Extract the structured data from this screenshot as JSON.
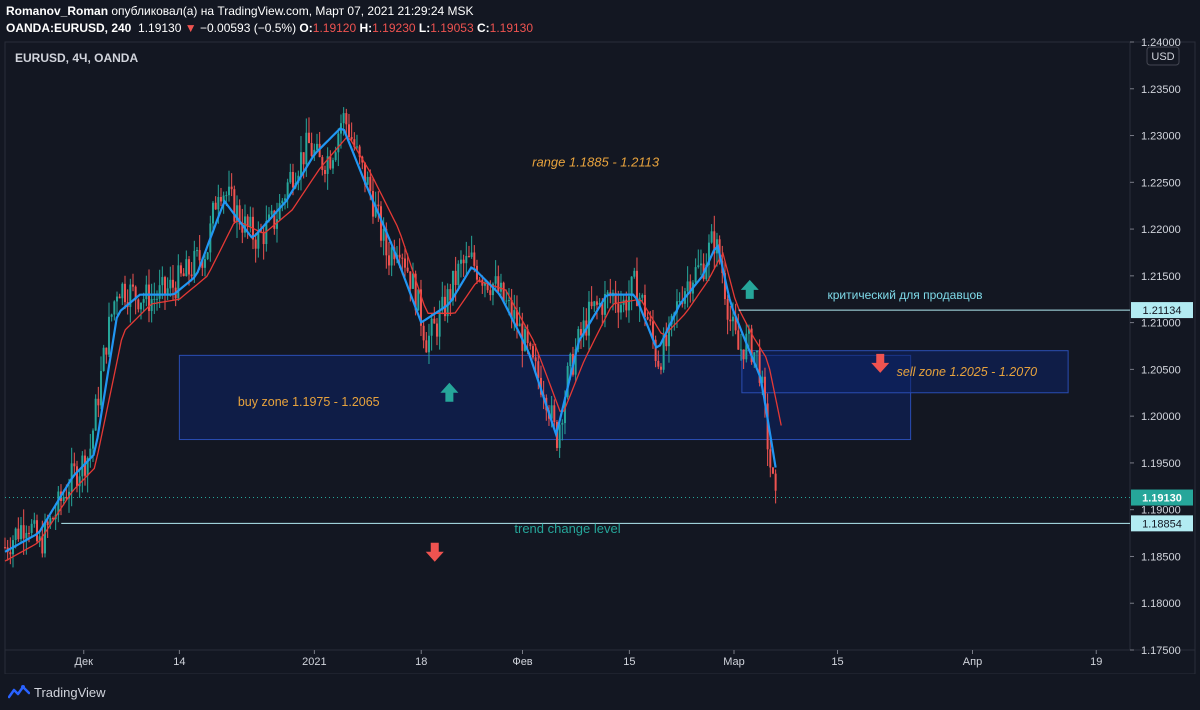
{
  "header": {
    "author": "Romanov_Roman",
    "published_text": "опубликовал(а) на TradingView.com, Март 07, 2021 21:29:24 MSK",
    "symbol": "OANDA:EURUSD, 240",
    "last": "1.19130",
    "change_arrow": "▼",
    "change": "−0.00593 (−0.5%)",
    "o_label": "O:",
    "o_value": "1.19120",
    "h_label": "H:",
    "h_value": "1.19230",
    "l_label": "L:",
    "l_value": "1.19053",
    "c_label": "C:",
    "c_value": "1.19130"
  },
  "footer": {
    "brand": "TradingView",
    "brand_icon": "tradingview-logo-icon"
  },
  "colors": {
    "background": "#131722",
    "up_candle": "#26a69a",
    "down_candle": "#ef5350",
    "ma_fast": "#2196f3",
    "ma_slow": "#e53935",
    "zone_fill": "#0d2266",
    "zone_border": "#2a4db3",
    "annotation_text": "#e8a33d",
    "level_line": "#b2ebf2",
    "trend_text": "#26a69a"
  },
  "chart_data": {
    "type": "candlestick",
    "title": "EURUSD, 4Ч, OANDA",
    "currency_label": "USD",
    "y_axis": {
      "ylim": [
        1.175,
        1.24
      ],
      "ticks": [
        "1.17500",
        "1.18000",
        "1.18500",
        "1.19000",
        "1.19500",
        "1.20000",
        "1.20500",
        "1.21000",
        "1.21500",
        "1.22000",
        "1.22500",
        "1.23000",
        "1.23500",
        "1.24000"
      ]
    },
    "x_axis": {
      "ticks": [
        {
          "label": "Дек",
          "t": 0.07
        },
        {
          "label": "14",
          "t": 0.155
        },
        {
          "label": "2021",
          "t": 0.275
        },
        {
          "label": "18",
          "t": 0.37
        },
        {
          "label": "Фев",
          "t": 0.46
        },
        {
          "label": "15",
          "t": 0.555
        },
        {
          "label": "Мар",
          "t": 0.648
        },
        {
          "label": "15",
          "t": 0.74
        },
        {
          "label": "Апр",
          "t": 0.86
        },
        {
          "label": "19",
          "t": 0.97
        }
      ]
    },
    "price_path": [
      [
        0.0,
        1.186
      ],
      [
        0.02,
        1.189
      ],
      [
        0.03,
        1.186
      ],
      [
        0.05,
        1.191
      ],
      [
        0.06,
        1.1935
      ],
      [
        0.075,
        1.196
      ],
      [
        0.09,
        1.208
      ],
      [
        0.1,
        1.214
      ],
      [
        0.115,
        1.213
      ],
      [
        0.13,
        1.2125
      ],
      [
        0.145,
        1.2135
      ],
      [
        0.16,
        1.215
      ],
      [
        0.18,
        1.218
      ],
      [
        0.19,
        1.225
      ],
      [
        0.2,
        1.223
      ],
      [
        0.215,
        1.22
      ],
      [
        0.225,
        1.219
      ],
      [
        0.24,
        1.221
      ],
      [
        0.255,
        1.226
      ],
      [
        0.27,
        1.229
      ],
      [
        0.28,
        1.227
      ],
      [
        0.29,
        1.228
      ],
      [
        0.3,
        1.232
      ],
      [
        0.305,
        1.231
      ],
      [
        0.315,
        1.227
      ],
      [
        0.325,
        1.224
      ],
      [
        0.34,
        1.217
      ],
      [
        0.35,
        1.219
      ],
      [
        0.365,
        1.213
      ],
      [
        0.375,
        1.208
      ],
      [
        0.385,
        1.21
      ],
      [
        0.395,
        1.213
      ],
      [
        0.405,
        1.216
      ],
      [
        0.415,
        1.2165
      ],
      [
        0.425,
        1.215
      ],
      [
        0.435,
        1.214
      ],
      [
        0.445,
        1.212
      ],
      [
        0.455,
        1.21
      ],
      [
        0.47,
        1.205
      ],
      [
        0.48,
        1.203
      ],
      [
        0.49,
        1.1975
      ],
      [
        0.5,
        1.204
      ],
      [
        0.51,
        1.208
      ],
      [
        0.52,
        1.211
      ],
      [
        0.53,
        1.212
      ],
      [
        0.54,
        1.213
      ],
      [
        0.55,
        1.212
      ],
      [
        0.56,
        1.214
      ],
      [
        0.57,
        1.211
      ],
      [
        0.58,
        1.206
      ],
      [
        0.59,
        1.208
      ],
      [
        0.6,
        1.213
      ],
      [
        0.61,
        1.215
      ],
      [
        0.62,
        1.216
      ],
      [
        0.63,
        1.219
      ],
      [
        0.637,
        1.216
      ],
      [
        0.645,
        1.21
      ],
      [
        0.652,
        1.207
      ],
      [
        0.66,
        1.208
      ],
      [
        0.67,
        1.206
      ],
      [
        0.68,
        1.195
      ],
      [
        0.685,
        1.1905
      ]
    ],
    "ma_fast_path": [
      [
        0.0,
        1.1855
      ],
      [
        0.03,
        1.1875
      ],
      [
        0.06,
        1.1935
      ],
      [
        0.08,
        1.196
      ],
      [
        0.1,
        1.211
      ],
      [
        0.12,
        1.213
      ],
      [
        0.15,
        1.213
      ],
      [
        0.17,
        1.215
      ],
      [
        0.195,
        1.223
      ],
      [
        0.22,
        1.219
      ],
      [
        0.25,
        1.223
      ],
      [
        0.275,
        1.228
      ],
      [
        0.3,
        1.231
      ],
      [
        0.32,
        1.225
      ],
      [
        0.345,
        1.218
      ],
      [
        0.37,
        1.21
      ],
      [
        0.395,
        1.212
      ],
      [
        0.415,
        1.216
      ],
      [
        0.44,
        1.213
      ],
      [
        0.465,
        1.207
      ],
      [
        0.49,
        1.198
      ],
      [
        0.51,
        1.208
      ],
      [
        0.535,
        1.213
      ],
      [
        0.56,
        1.213
      ],
      [
        0.58,
        1.207
      ],
      [
        0.6,
        1.212
      ],
      [
        0.62,
        1.215
      ],
      [
        0.633,
        1.2185
      ],
      [
        0.645,
        1.212
      ],
      [
        0.66,
        1.2075
      ],
      [
        0.672,
        1.204
      ],
      [
        0.685,
        1.1945
      ]
    ],
    "ma_slow_path": [
      [
        0.0,
        1.1845
      ],
      [
        0.03,
        1.1865
      ],
      [
        0.06,
        1.192
      ],
      [
        0.08,
        1.1945
      ],
      [
        0.105,
        1.209
      ],
      [
        0.13,
        1.212
      ],
      [
        0.155,
        1.2125
      ],
      [
        0.18,
        1.215
      ],
      [
        0.205,
        1.221
      ],
      [
        0.23,
        1.2195
      ],
      [
        0.255,
        1.222
      ],
      [
        0.28,
        1.2265
      ],
      [
        0.305,
        1.23
      ],
      [
        0.325,
        1.226
      ],
      [
        0.35,
        1.22
      ],
      [
        0.375,
        1.211
      ],
      [
        0.4,
        1.211
      ],
      [
        0.42,
        1.2145
      ],
      [
        0.445,
        1.2135
      ],
      [
        0.47,
        1.208
      ],
      [
        0.495,
        1.2
      ],
      [
        0.515,
        1.206
      ],
      [
        0.54,
        1.212
      ],
      [
        0.565,
        1.2125
      ],
      [
        0.585,
        1.2085
      ],
      [
        0.605,
        1.211
      ],
      [
        0.625,
        1.2145
      ],
      [
        0.638,
        1.2175
      ],
      [
        0.65,
        1.212
      ],
      [
        0.665,
        1.2085
      ],
      [
        0.678,
        1.206
      ],
      [
        0.69,
        1.199
      ]
    ],
    "zones": [
      {
        "name": "buy-zone",
        "t0": 0.155,
        "t1": 0.805,
        "p_low": 1.1975,
        "p_high": 1.2065,
        "label": "buy zone 1.1975 - 1.2065",
        "label_t": 0.27,
        "label_p": 1.2015
      },
      {
        "name": "sell-zone",
        "t0": 0.655,
        "t1": 0.945,
        "p_low": 1.2025,
        "p_high": 1.207,
        "label": "sell zone 1.2025 - 1.2070",
        "label_t": 0.855,
        "label_p": 1.2047
      }
    ],
    "levels": [
      {
        "name": "critical-level",
        "price": 1.21134,
        "label": "1.21134",
        "t0": 0.652,
        "text": "критический для продавцов",
        "text_t": 0.8,
        "text_p": 1.2125
      },
      {
        "name": "trend-change-level",
        "price": 1.18854,
        "label": "1.18854",
        "t0": 0.05,
        "text": "trend change level",
        "text_t": 0.5,
        "text_p": 1.1875
      },
      {
        "name": "last-price",
        "price": 1.1913,
        "label": "1.19130",
        "dotted": true
      }
    ],
    "annotations": [
      {
        "name": "range-label",
        "text": "range 1.1885 - 1.2113",
        "t": 0.525,
        "p": 1.2267
      }
    ],
    "arrows": [
      {
        "name": "buy-arrow-up",
        "dir": "up",
        "t": 0.395,
        "p": 1.2025,
        "color": "#26a69a"
      },
      {
        "name": "critical-arrow-up",
        "dir": "up",
        "t": 0.662,
        "p": 1.2135,
        "color": "#26a69a"
      },
      {
        "name": "sell-arrow-down",
        "dir": "down",
        "t": 0.778,
        "p": 1.2057,
        "color": "#ef5350"
      },
      {
        "name": "trend-arrow-down",
        "dir": "down",
        "t": 0.382,
        "p": 1.1855,
        "color": "#ef5350"
      }
    ]
  }
}
